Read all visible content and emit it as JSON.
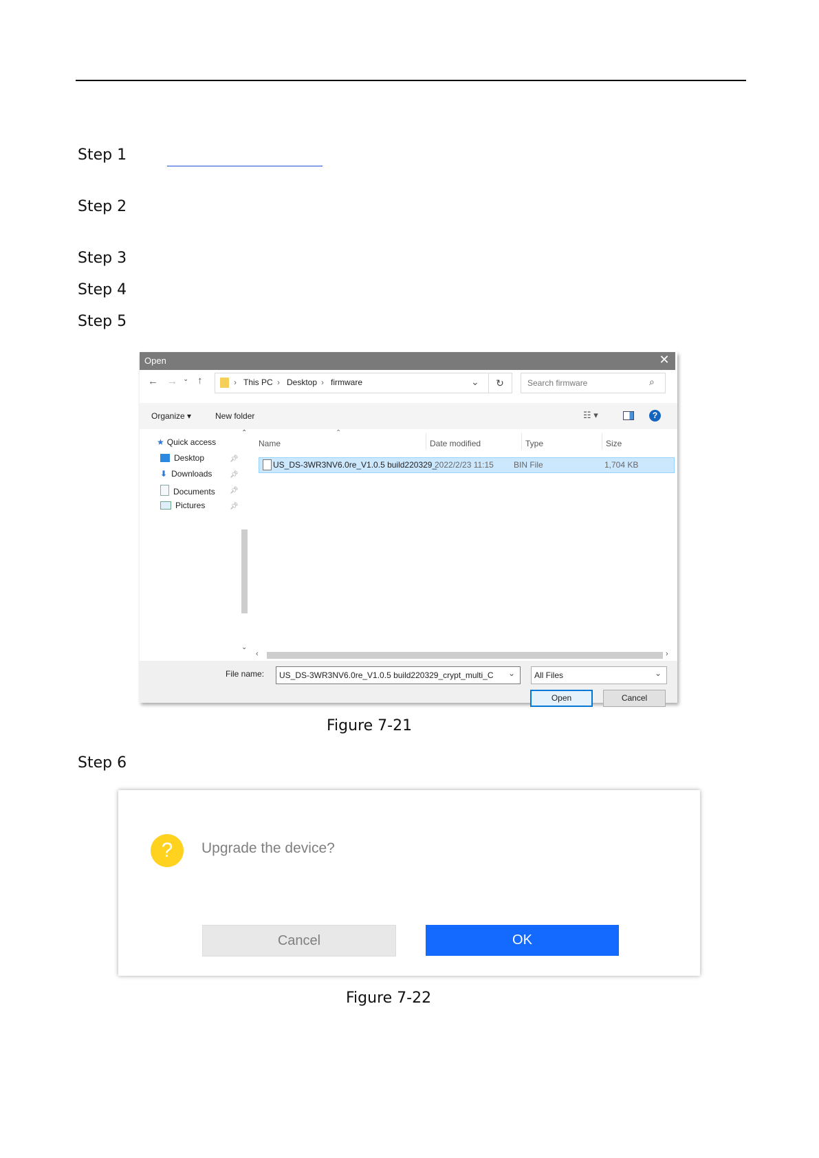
{
  "steps": [
    "Step 1",
    "Step 2",
    "Step 3",
    "Step 4",
    "Step 5",
    "Step 6"
  ],
  "figure1": {
    "caption": "Figure 7-21",
    "title": "Open",
    "nav": {
      "breadcrumb": [
        "This PC",
        "Desktop",
        "firmware"
      ],
      "search_placeholder": "Search firmware"
    },
    "commands": {
      "organize": "Organize",
      "new_folder": "New folder"
    },
    "sidebar": [
      {
        "label": "Quick access",
        "icon": "star-icon"
      },
      {
        "label": "Desktop",
        "icon": "desktop-icon"
      },
      {
        "label": "Downloads",
        "icon": "download-icon"
      },
      {
        "label": "Documents",
        "icon": "documents-icon"
      },
      {
        "label": "Pictures",
        "icon": "pictures-icon"
      }
    ],
    "columns": {
      "name": "Name",
      "date": "Date modified",
      "type": "Type",
      "size": "Size"
    },
    "file": {
      "name": "US_DS-3WR3NV6.0re_V1.0.5 build220329_",
      "date": "2022/2/23 11:15",
      "type": "BIN File",
      "size": "1,704 KB"
    },
    "file_name_label": "File name:",
    "file_name_value": "US_DS-3WR3NV6.0re_V1.0.5 build220329_crypt_multi_C",
    "file_type": "All Files",
    "open_label": "Open",
    "cancel_label": "Cancel"
  },
  "figure2": {
    "caption": "Figure 7-22",
    "icon_glyph": "?",
    "message": "Upgrade the device?",
    "cancel_label": "Cancel",
    "ok_label": "OK"
  }
}
